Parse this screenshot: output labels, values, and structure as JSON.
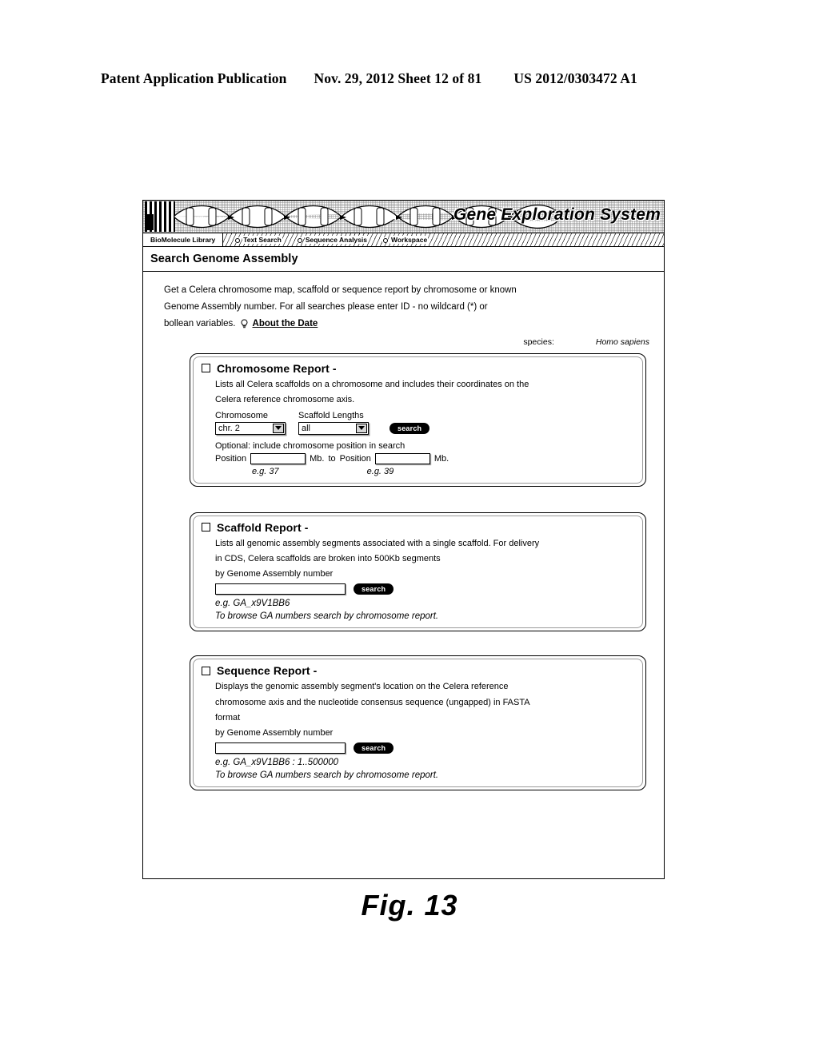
{
  "patent_header": {
    "left": "Patent Application Publication",
    "middle": "Nov. 29, 2012  Sheet 12 of 81",
    "right": "US 2012/0303472 A1"
  },
  "banner": {
    "title": "Gene Exploration System",
    "logo_icon": "checkered-logo-icon",
    "dna_icon": "dna-helix-icon"
  },
  "navbar": {
    "tabs": [
      {
        "label": "BioMolecule Library",
        "active": true
      },
      {
        "label": "Text Search",
        "active": false
      },
      {
        "label": "Sequence Analysis",
        "active": false
      },
      {
        "label": "Workspace",
        "active": false
      }
    ]
  },
  "page": {
    "title": "Search Genome Assembly"
  },
  "intro": {
    "line1": "Get a Celera chromosome map, scaffold or sequence report by chromosome or known",
    "line2": "Genome Assembly number.  For all searches please enter ID - no wildcard (*) or",
    "line3": "bollean variables.",
    "about_link": "About the Date",
    "bulb_icon": "lightbulb-icon"
  },
  "species": {
    "label": "species:",
    "value": "Homo sapiens"
  },
  "chromosome_report": {
    "title": "Chromosome Report -",
    "desc_line1": "Lists all Celera scaffolds on a chromosome and includes their coordinates on the",
    "desc_line2": "Celera reference chromosome axis.",
    "label_chromosome": "Chromosome",
    "label_scaffold_lengths": "Scaffold Lengths",
    "chromosome_value": "chr. 2",
    "scaffold_value": "all",
    "search_label": "search",
    "optional_line": "Optional:  include chromosome position in search",
    "position_label_1": "Position",
    "position_value_1": "",
    "unit_1": "Mb.",
    "to_label": "to",
    "position_label_2": "Position",
    "position_value_2": "",
    "unit_2": "Mb.",
    "eg_1": "e.g. 37",
    "eg_2": "e.g. 39"
  },
  "scaffold_report": {
    "title": "Scaffold Report -",
    "desc_line1": "Lists all genomic assembly segments associated with a single scaffold.  For delivery",
    "desc_line2": "in CDS, Celera scaffolds are broken into 500Kb segments",
    "desc_line3": "by Genome Assembly number",
    "input_value": "",
    "search_label": "search",
    "eg_text": "e.g. GA_x9V1BB6",
    "note_text": "To browse GA numbers search by chromosome report."
  },
  "sequence_report": {
    "title": "Sequence Report -",
    "desc_line1": "Displays the genomic assembly segment's location on the Celera reference",
    "desc_line2": "chromosome axis and the nucleotide consensus sequence (ungapped) in FASTA",
    "desc_line3": "format",
    "desc_line4": "by Genome Assembly number",
    "input_value": "",
    "search_label": "search",
    "eg_text": "e.g. GA_x9V1BB6 : 1..500000",
    "note_text": "To browse GA numbers search by chromosome report."
  },
  "figure": {
    "caption": "Fig. 13"
  }
}
